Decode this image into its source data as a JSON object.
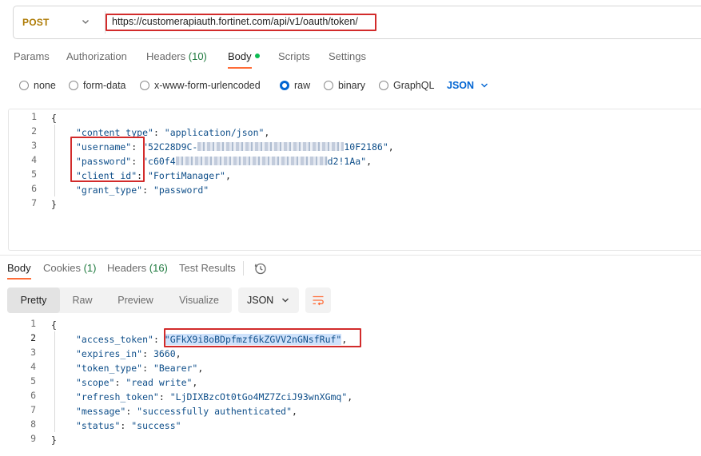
{
  "request": {
    "method": "POST",
    "url": "https://customerapiauth.fortinet.com/api/v1/oauth/token/"
  },
  "request_tabs": [
    {
      "label": "Params"
    },
    {
      "label": "Authorization"
    },
    {
      "label": "Headers",
      "count": "(10)"
    },
    {
      "label": "Body"
    },
    {
      "label": "Scripts"
    },
    {
      "label": "Settings"
    }
  ],
  "body_types": [
    "none",
    "form-data",
    "x-www-form-urlencoded",
    "raw",
    "binary",
    "GraphQL"
  ],
  "body_format": "JSON",
  "request_body": {
    "line_numbers": [
      "1",
      "2",
      "3",
      "4",
      "5",
      "6",
      "7"
    ],
    "open_brace": "{",
    "close_brace": "}",
    "lines": [
      {
        "key": "\"content_type\"",
        "sep": ": ",
        "value": "\"application/json\"",
        "end": ","
      },
      {
        "key": "\"username\"",
        "sep": ": ",
        "value_start": "\"52C28D9C-",
        "value_end": "10F2186\"",
        "end": ","
      },
      {
        "key": "\"password\"",
        "sep": ": ",
        "value_start": "\"c60f4",
        "value_end": "d2!1Aa\"",
        "end": ","
      },
      {
        "key": "\"client_id\"",
        "sep": ": ",
        "value": "\"FortiManager\"",
        "end": ","
      },
      {
        "key": "\"grant_type\"",
        "sep": ": ",
        "value": "\"password\"",
        "end": ""
      }
    ]
  },
  "response_tabs": [
    {
      "label": "Body"
    },
    {
      "label": "Cookies",
      "count": "(1)"
    },
    {
      "label": "Headers",
      "count": "(16)"
    },
    {
      "label": "Test Results"
    }
  ],
  "view_modes": [
    "Pretty",
    "Raw",
    "Preview",
    "Visualize"
  ],
  "response_format": "JSON",
  "response_body": {
    "line_numbers": [
      "1",
      "2",
      "3",
      "4",
      "5",
      "6",
      "7",
      "8",
      "9"
    ],
    "open_brace": "{",
    "close_brace": "}",
    "lines": [
      {
        "key": "\"access_token\"",
        "sep": ": ",
        "value": "\"GFkX9i8oBDpfmzf6kZGVV2nGNsfRuf\"",
        "end": ","
      },
      {
        "key": "\"expires_in\"",
        "sep": ": ",
        "value": "3660",
        "end": ","
      },
      {
        "key": "\"token_type\"",
        "sep": ": ",
        "value": "\"Bearer\"",
        "end": ","
      },
      {
        "key": "\"scope\"",
        "sep": ": ",
        "value": "\"read write\"",
        "end": ","
      },
      {
        "key": "\"refresh_token\"",
        "sep": ": ",
        "value": "\"LjDIXBzcOt0tGo4MZ7ZciJ93wnXGmq\"",
        "end": ","
      },
      {
        "key": "\"message\"",
        "sep": ": ",
        "value": "\"successfully authenticated\"",
        "end": ","
      },
      {
        "key": "\"status\"",
        "sep": ": ",
        "value": "\"success\"",
        "end": ""
      }
    ]
  },
  "colors": {
    "method": "#ad7a03",
    "accent": "#ff6c37",
    "highlight_box": "#d22b2b",
    "link_blue": "#0265d2",
    "json_string": "#0f4f8a"
  },
  "icons": [
    "chevron-down-icon",
    "history-icon",
    "wrap-lines-icon"
  ]
}
